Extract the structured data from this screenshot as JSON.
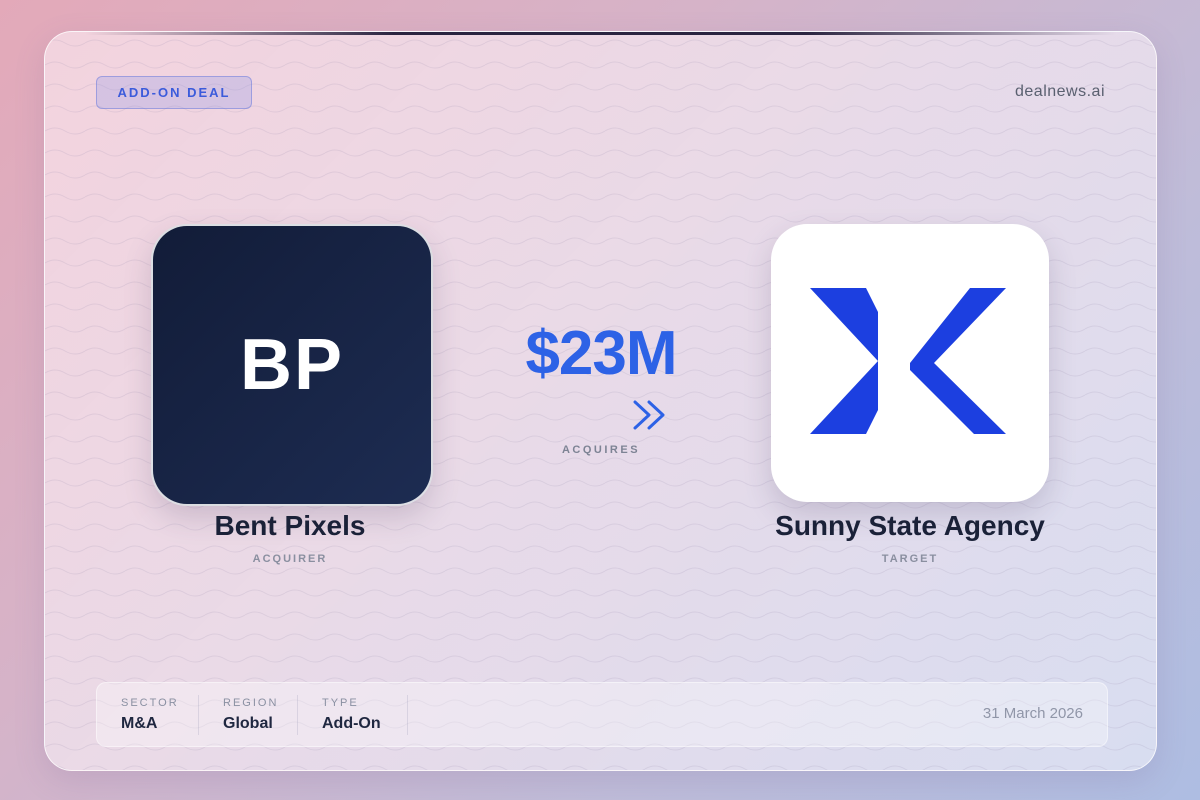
{
  "badge": "ADD-ON DEAL",
  "brand": "dealnews.ai",
  "acquirer": {
    "logo_text": "BP",
    "name": "Bent Pixels",
    "role": "ACQUIRER"
  },
  "deal": {
    "amount": "$23M",
    "verb": "ACQUIRES"
  },
  "target": {
    "logo_icon": "x-logo-icon",
    "name": "Sunny State Agency",
    "role": "TARGET"
  },
  "meta": [
    {
      "label": "SECTOR",
      "value": "M&A"
    },
    {
      "label": "REGION",
      "value": "Global"
    },
    {
      "label": "TYPE",
      "value": "Add-On"
    }
  ],
  "date": "31 March 2026",
  "colors": {
    "accent": "#2d62e6",
    "acquirer_tile": "#16213f",
    "target_logo": "#1c3fe0"
  }
}
